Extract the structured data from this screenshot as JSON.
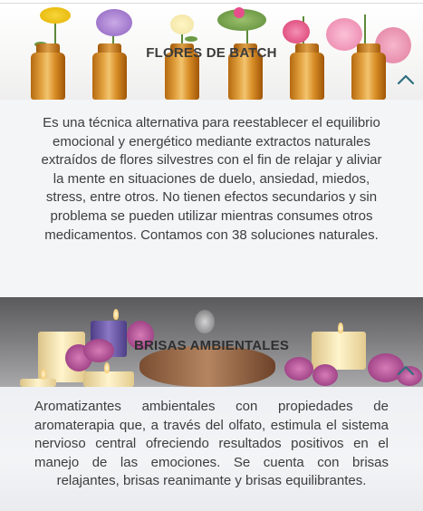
{
  "sections": [
    {
      "title": "FLORES DE BATCH",
      "toggle_icon": "chevron-up-icon",
      "description": "Es una técnica alternativa para reestablecer el equilibrio emocional y energético mediante extractos naturales extraídos de flores silvestres con el fin de relajar y aliviar la mente en situaciones de duelo, ansiedad, miedos, stress, entre otros. No tienen efectos secundarios y sin problema se pueden utilizar mientras consumes otros medicamentos. Contamos con 38 soluciones naturales."
    },
    {
      "title": "BRISAS AMBIENTALES",
      "toggle_icon": "chevron-up-icon",
      "description": "Aromatizantes ambientales con propiedades de aromaterapia que, a través del olfato, estimula el sistema nervioso central ofreciendo resultados positivos en el manejo de las emociones. Se cuenta con brisas relajantes, brisas reanimante y brisas equilibrantes."
    }
  ],
  "colors": {
    "title": "#3c3c3c",
    "text": "#3d3d3d",
    "chevron": "#2f6f7e",
    "bottle": "#e1a03e"
  }
}
